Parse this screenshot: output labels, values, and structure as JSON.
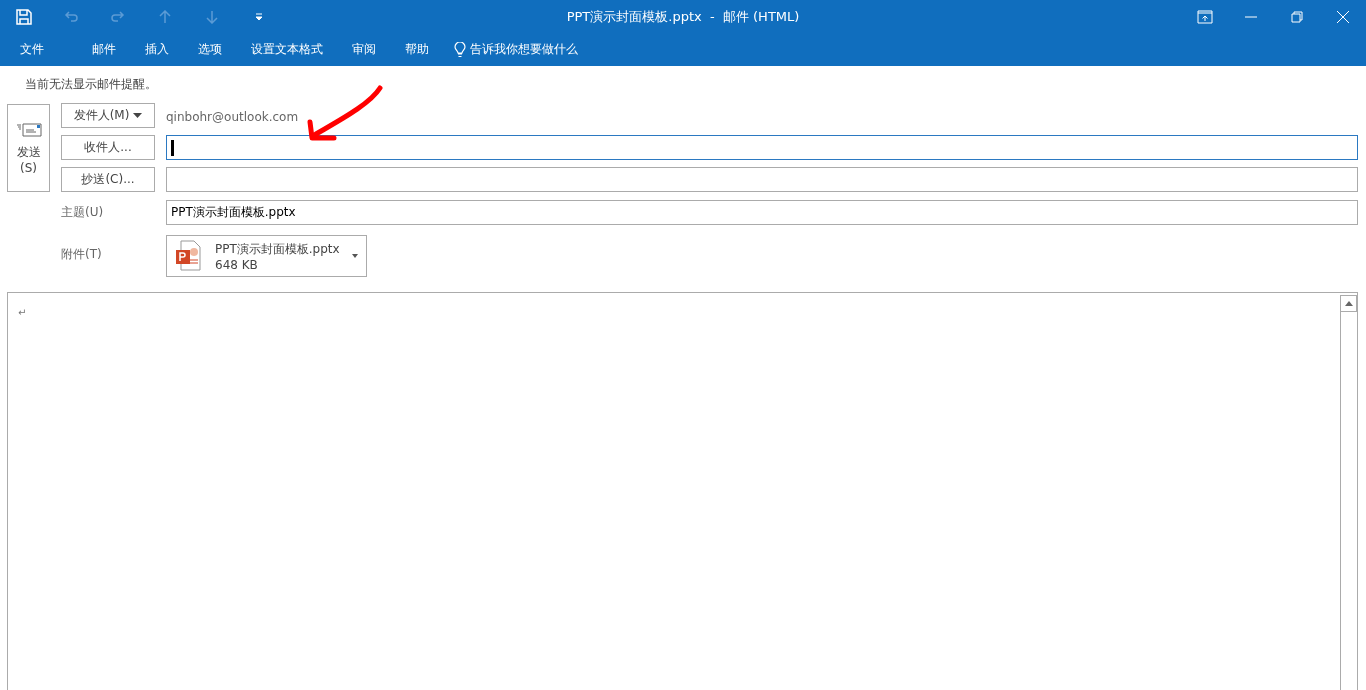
{
  "window": {
    "title": "PPT演示封面模板.pptx  -  邮件 (HTML)"
  },
  "ribbon_tabs": [
    {
      "label": "文件",
      "selected": false
    },
    {
      "label": "邮件",
      "selected": false
    },
    {
      "label": "插入",
      "selected": false
    },
    {
      "label": "选项",
      "selected": false
    },
    {
      "label": "设置文本格式",
      "selected": false
    },
    {
      "label": "审阅",
      "selected": false
    },
    {
      "label": "帮助",
      "selected": false
    }
  ],
  "tell_me": "告诉我你想要做什么",
  "notice": "当前无法显示邮件提醒。",
  "send_button": {
    "label": "发送",
    "shortcut": "(S)"
  },
  "from": {
    "button": "发件人(M)",
    "value": "qinbohr@outlook.com"
  },
  "to": {
    "button": "收件人...",
    "focused": true
  },
  "cc": {
    "button": "抄送(C)..."
  },
  "subject": {
    "label": "主题(U)",
    "value": "PPT演示封面模板.pptx"
  },
  "attachment": {
    "label": "附件(T)",
    "file_name": "PPT演示封面模板.pptx",
    "size": "648 KB"
  },
  "body": {
    "text": "↵"
  }
}
